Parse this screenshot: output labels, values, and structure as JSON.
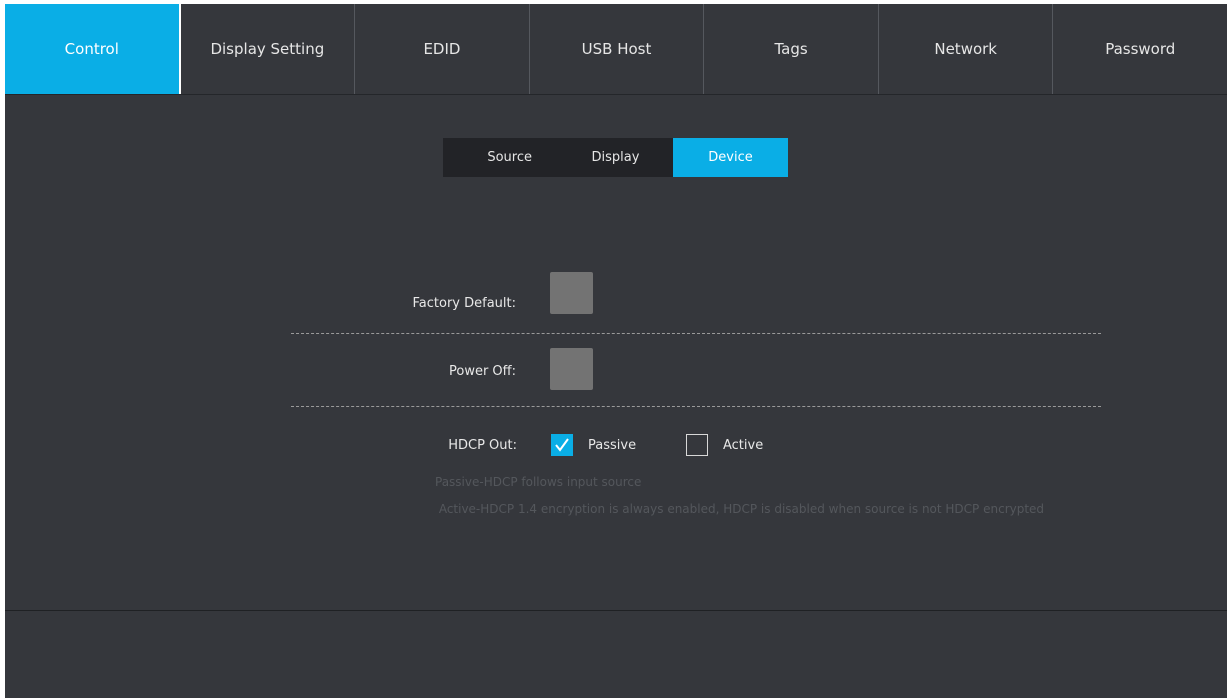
{
  "top_tabs": [
    {
      "label": "Control",
      "active": true
    },
    {
      "label": "Display Setting",
      "active": false
    },
    {
      "label": "EDID",
      "active": false
    },
    {
      "label": "USB Host",
      "active": false
    },
    {
      "label": "Tags",
      "active": false
    },
    {
      "label": "Network",
      "active": false
    },
    {
      "label": "Password",
      "active": false
    }
  ],
  "sub_tabs": [
    {
      "label": "Source",
      "active": false
    },
    {
      "label": "Display",
      "active": false
    },
    {
      "label": "Device",
      "active": true
    }
  ],
  "device": {
    "factory_default_label": "Factory Default:",
    "power_off_label": "Power Off:",
    "hdcp_out_label": "HDCP Out:",
    "hdcp_options": [
      {
        "label": "Passive",
        "checked": true
      },
      {
        "label": "Active",
        "checked": false
      }
    ],
    "notes": [
      "Passive-HDCP follows input source",
      " Active-HDCP 1.4 encryption is always enabled, HDCP is disabled when source is not HDCP encrypted"
    ]
  },
  "colors": {
    "accent": "#0aaee6",
    "background": "#35373c",
    "subnav_background": "#222327",
    "button_gray": "#737373"
  }
}
